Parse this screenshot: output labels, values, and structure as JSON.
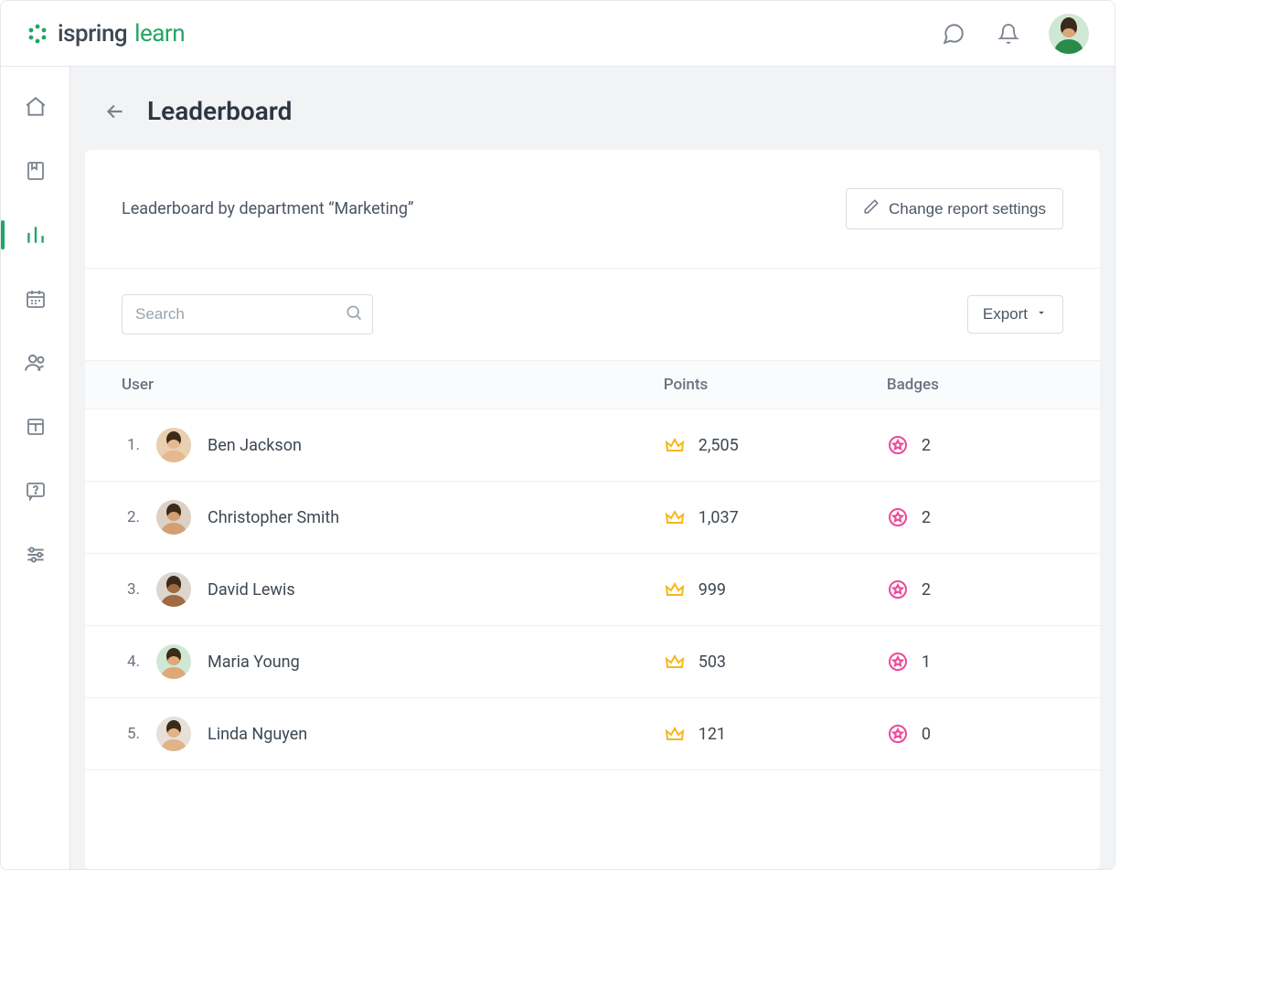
{
  "brand": {
    "name1": "ispring",
    "name2": "learn"
  },
  "page": {
    "title": "Leaderboard",
    "description": "Leaderboard by department “Marketing”",
    "change_settings_label": "Change report settings",
    "search_placeholder": "Search",
    "export_label": "Export"
  },
  "table": {
    "headers": {
      "user": "User",
      "points": "Points",
      "badges": "Badges"
    },
    "rows": [
      {
        "rank": "1.",
        "name": "Ben Jackson",
        "points": "2,505",
        "badges": "2",
        "bg": "#e8d0b0",
        "skin": "#e6b890"
      },
      {
        "rank": "2.",
        "name": "Christopher Smith",
        "points": "1,037",
        "badges": "2",
        "bg": "#ded0c4",
        "skin": "#d2a074"
      },
      {
        "rank": "3.",
        "name": "David Lewis",
        "points": "999",
        "badges": "2",
        "bg": "#dcd6ce",
        "skin": "#a06a44"
      },
      {
        "rank": "4.",
        "name": "Maria Young",
        "points": "503",
        "badges": "1",
        "bg": "#cfe8d6",
        "skin": "#e0a878"
      },
      {
        "rank": "5.",
        "name": "Linda Nguyen",
        "points": "121",
        "badges": "0",
        "bg": "#e8e0d8",
        "skin": "#e0b488"
      }
    ]
  }
}
